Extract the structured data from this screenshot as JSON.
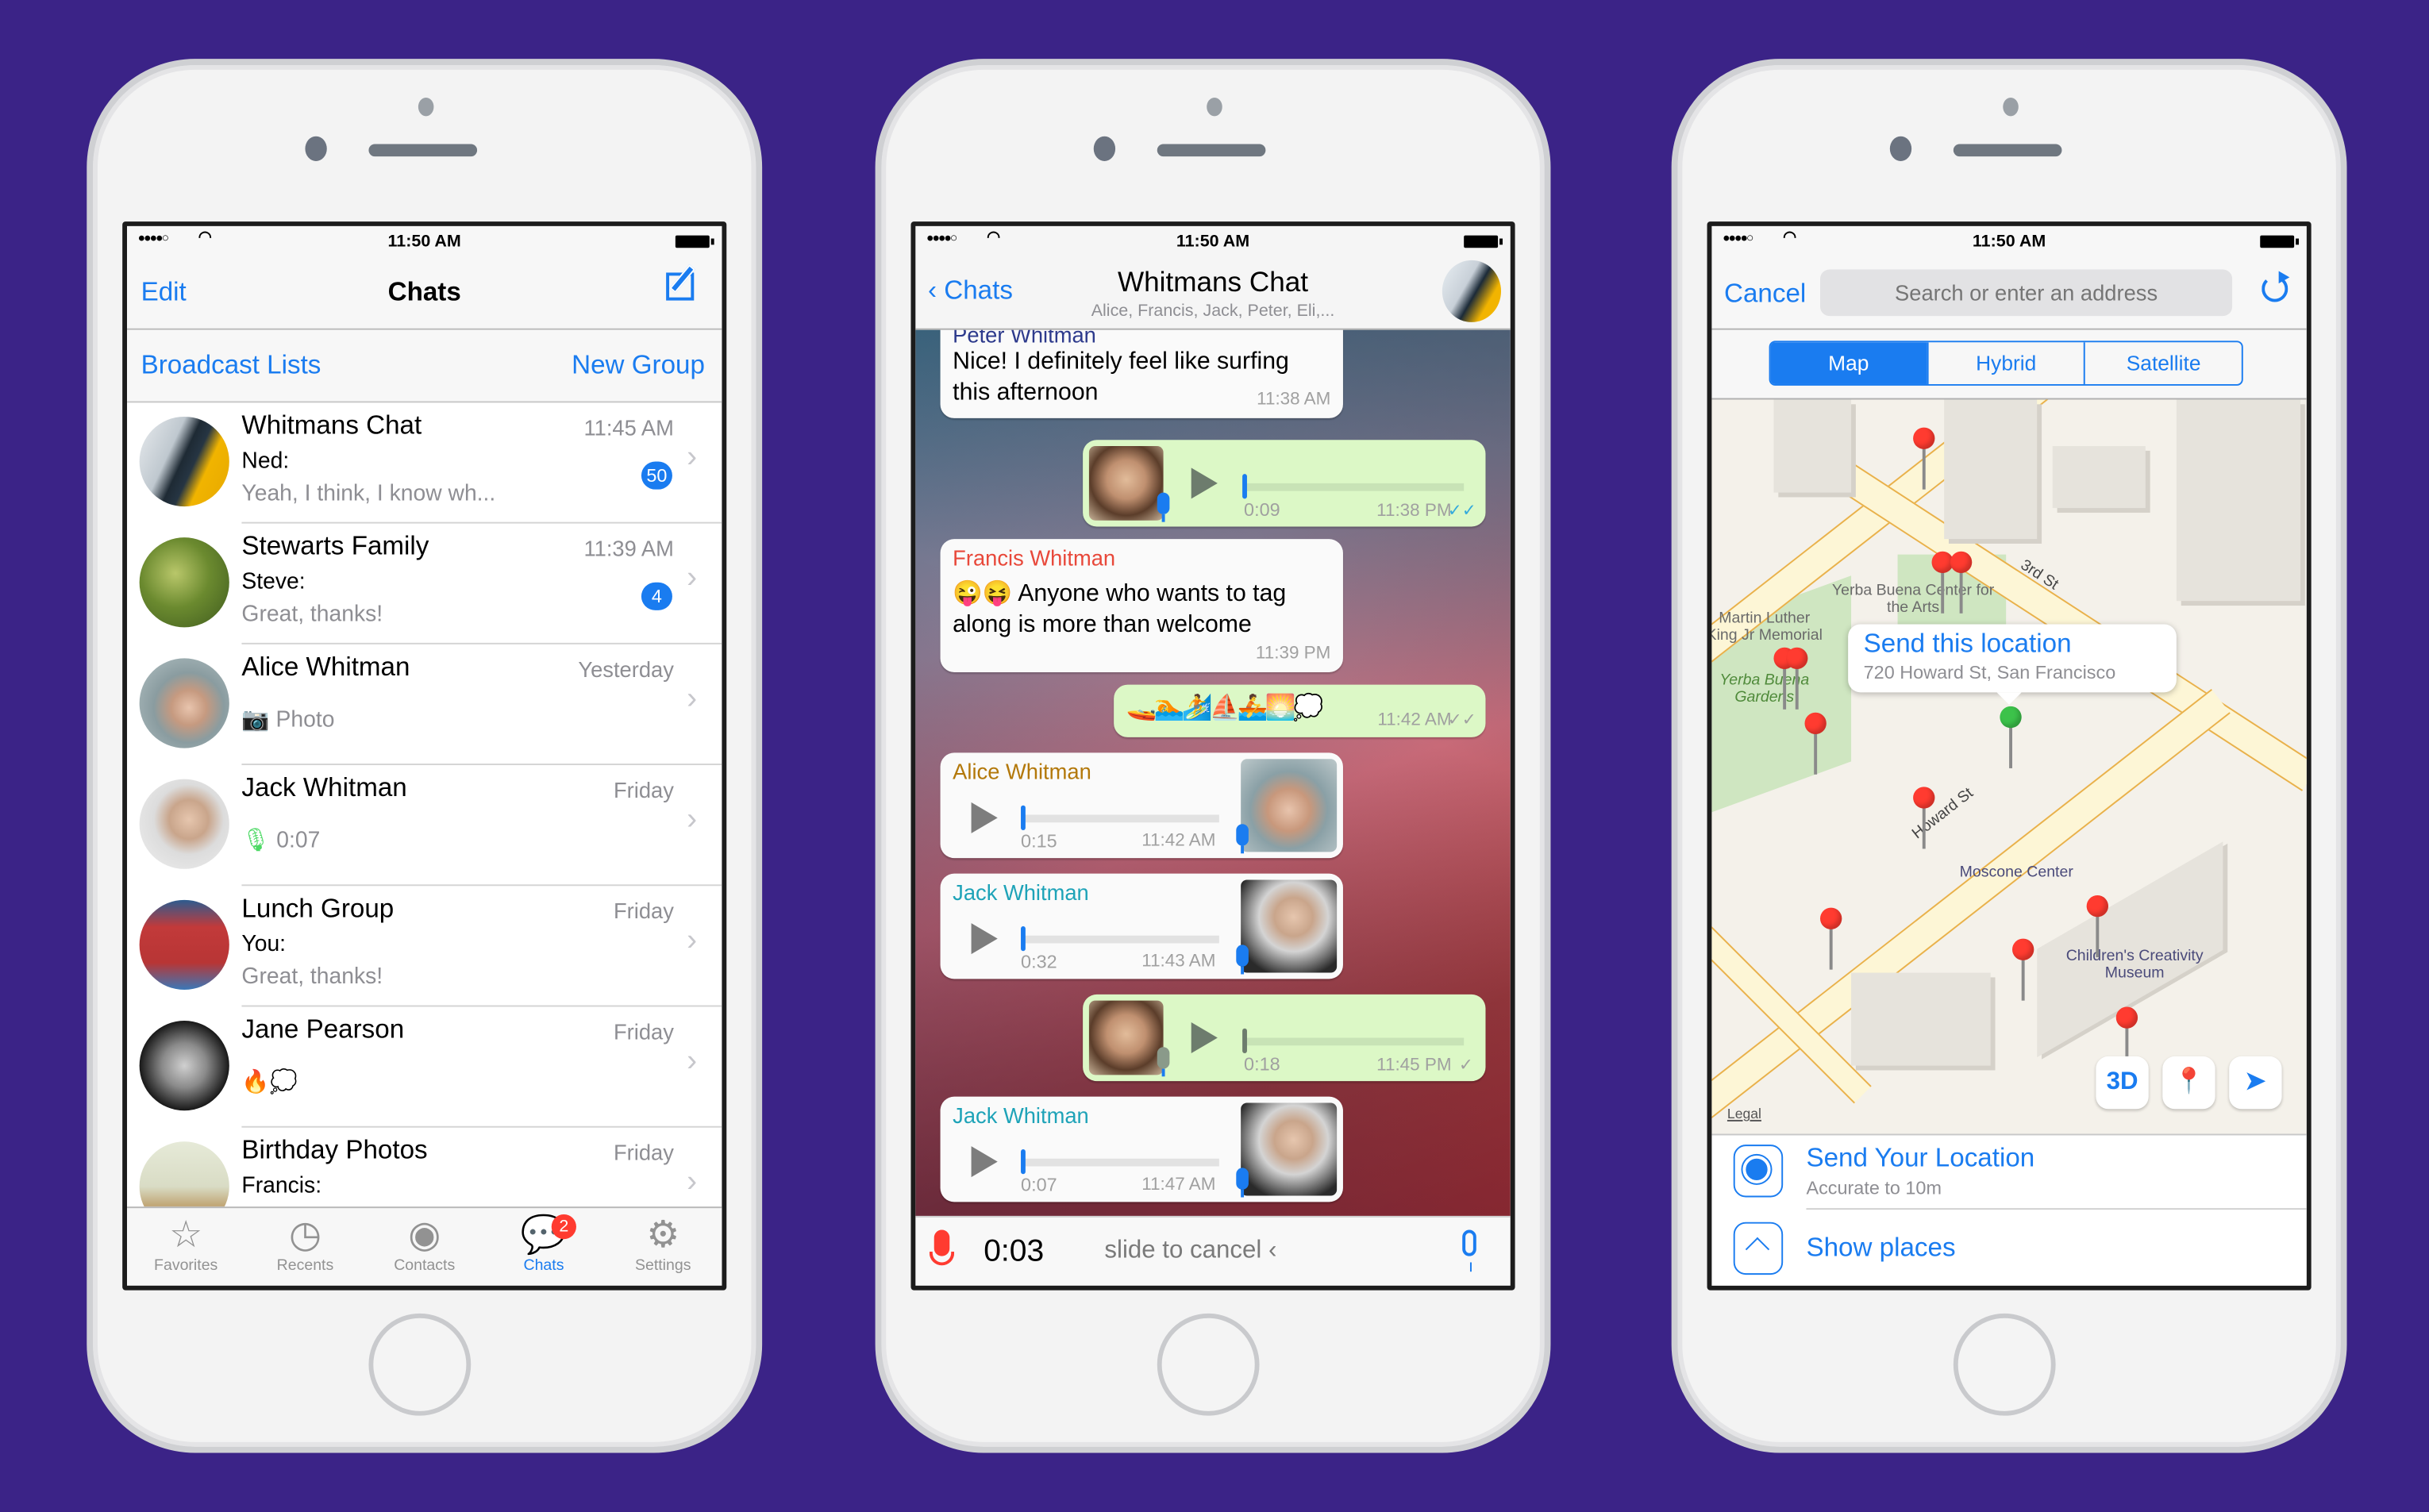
{
  "status_bar": {
    "signal": "●●●●○",
    "time": "11:50 AM"
  },
  "colors": {
    "background": "#3b2387",
    "accent": "#1a7cf0",
    "bubble_out": "#dcf8c6",
    "badge": "#ff3b30"
  },
  "chats_screen": {
    "nav": {
      "edit": "Edit",
      "title": "Chats",
      "compose_icon": "compose-icon"
    },
    "actions": {
      "broadcast": "Broadcast Lists",
      "new_group": "New Group"
    },
    "rows": [
      {
        "name": "Whitmans Chat",
        "time": "11:45 AM",
        "line1": "Ned:",
        "line2": "Yeah, I think, I know wh...",
        "unread": "50"
      },
      {
        "name": "Stewarts Family",
        "time": "11:39 AM",
        "line1": "Steve:",
        "line2": "Great, thanks!",
        "unread": "4"
      },
      {
        "name": "Alice Whitman",
        "time": "Yesterday",
        "preview": "Photo",
        "preview_icon": "camera-icon"
      },
      {
        "name": "Jack Whitman",
        "time": "Friday",
        "preview": "0:07",
        "preview_icon": "microphone-icon"
      },
      {
        "name": "Lunch Group",
        "time": "Friday",
        "line1": "You:",
        "line2": "Great, thanks!"
      },
      {
        "name": "Jane Pearson",
        "time": "Friday",
        "preview": "🔥💭"
      },
      {
        "name": "Birthday Photos",
        "time": "Friday",
        "line1": "Francis:"
      }
    ],
    "tabs": [
      {
        "label": "Favorites",
        "icon": "☆"
      },
      {
        "label": "Recents",
        "icon": "◷"
      },
      {
        "label": "Contacts",
        "icon": "◉"
      },
      {
        "label": "Chats",
        "icon": "💬",
        "badge": "2",
        "active": true
      },
      {
        "label": "Settings",
        "icon": "⚙"
      }
    ]
  },
  "conversation_screen": {
    "back": "Chats",
    "title": "Whitmans Chat",
    "subtitle": "Alice, Francis, Jack, Peter, Eli,...",
    "messages": [
      {
        "direction": "in",
        "sender": "Peter Whitman",
        "text": "Nice! I definitely feel like surfing this afternoon",
        "time": "11:38 AM"
      },
      {
        "direction": "out",
        "type": "voice",
        "duration": "0:09",
        "time": "11:38 PM",
        "status": "✓✓"
      },
      {
        "direction": "in",
        "sender": "Francis Whitman",
        "text": "😜😝 Anyone who wants to tag along is more than welcome",
        "time": "11:39 PM"
      },
      {
        "direction": "out",
        "text": "🚤🏊🏄⛵🚣🌅💭",
        "time": "11:42 AM",
        "status": "✓✓"
      },
      {
        "direction": "in",
        "type": "voice",
        "sender": "Alice Whitman",
        "duration": "0:15",
        "time": "11:42 AM"
      },
      {
        "direction": "in",
        "type": "voice",
        "sender": "Jack Whitman",
        "duration": "0:32",
        "time": "11:43 AM"
      },
      {
        "direction": "out",
        "type": "voice",
        "duration": "0:18",
        "time": "11:45 PM",
        "status": "✓"
      },
      {
        "direction": "in",
        "type": "voice",
        "sender": "Jack Whitman",
        "duration": "0:07",
        "time": "11:47 AM"
      }
    ],
    "sender_colors": {
      "Peter Whitman": "#2d3a8c",
      "Francis Whitman": "#e8483a",
      "Alice Whitman": "#b3780a",
      "Jack Whitman": "#1ea3b8"
    },
    "recorder": {
      "elapsed": "0:03",
      "hint": "slide to cancel ‹"
    }
  },
  "location_screen": {
    "cancel": "Cancel",
    "search_placeholder": "Search or enter an address",
    "segments": [
      {
        "label": "Map",
        "selected": true
      },
      {
        "label": "Hybrid"
      },
      {
        "label": "Satellite"
      }
    ],
    "map_labels": {
      "yerba_center": "Yerba Buena Center for the Arts",
      "mlk": "Martin Luther King Jr Memorial",
      "yerba_gardens": "Yerba Buena Gardens",
      "third_st": "3rd St",
      "howard_st": "Howard St",
      "moscone": "Moscone Center",
      "childrens": "Children's Creativity Museum",
      "legal": "Legal"
    },
    "callout": {
      "title": "Send this location",
      "address": "720 Howard St, San Francisco"
    },
    "map_buttons": {
      "three_d": "3D"
    },
    "send_location": {
      "title": "Send Your Location",
      "subtitle": "Accurate to 10m"
    },
    "show_places": "Show places"
  }
}
